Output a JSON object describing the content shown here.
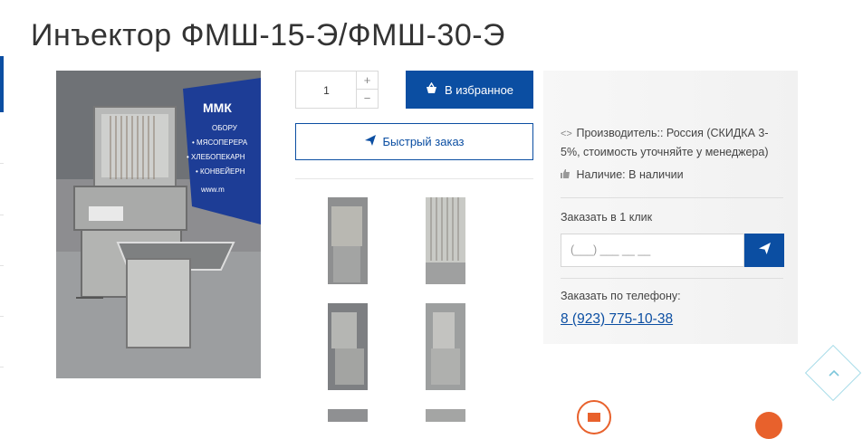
{
  "product": {
    "title": "Инъектор ФМШ-15-Э/ФМШ-30-Э"
  },
  "purchase": {
    "quantity": "1",
    "plus_label": "+",
    "minus_label": "−",
    "favorite_label": "В избранное",
    "quick_order_label": "Быстрый заказ"
  },
  "info": {
    "manufacturer_label": "Производитель::",
    "manufacturer_value": "Россия (СКИДКА 3-5%, стоимость уточняйте у менеджера)",
    "availability_label": "Наличие:",
    "availability_value": "В наличии",
    "one_click_label": "Заказать в 1 клик",
    "phone_placeholder": "(___) ___ __ __",
    "by_phone_label": "Заказать по телефону:",
    "phone_number": "8 (923) 775-10-38"
  },
  "photo_banner": {
    "brand": "ММК",
    "line1": "ОБОРУ",
    "line2": "• МЯСОПЕРЕРА",
    "line3": "• ХЛЕБОПЕКАРН",
    "line4": "• КОНВЕЙЕРН",
    "line5": "www.m"
  },
  "colors": {
    "accent": "#0b4ea2",
    "orange": "#e8612c",
    "scroll_top": "#a6dbe8"
  },
  "icons": {
    "favorite": "basket-icon",
    "quick_order": "paper-plane-icon",
    "send": "paper-plane-icon",
    "manufacturer": "code-icon",
    "availability": "thumbs-up-icon",
    "scroll_top": "chevron-up-icon",
    "mail": "mail-icon"
  }
}
